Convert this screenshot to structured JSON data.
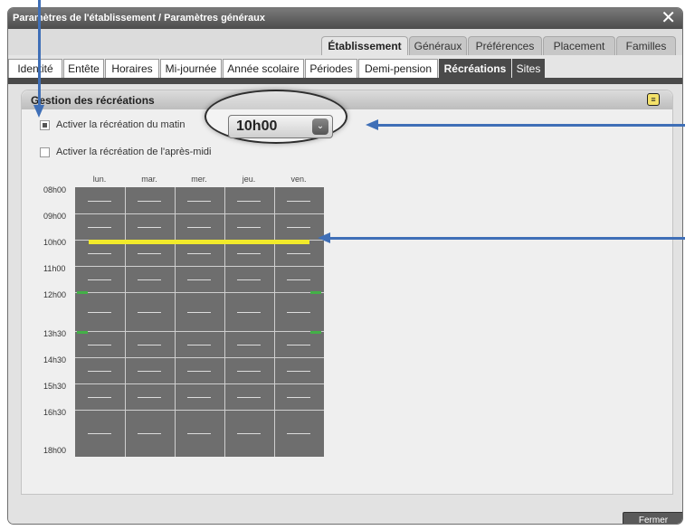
{
  "window": {
    "title": "Paramètres de l'établissement / Paramètres généraux",
    "close_glyph": "✕"
  },
  "tabs_primary": [
    {
      "label": "Établissement",
      "active": true
    },
    {
      "label": "Généraux",
      "active": false
    },
    {
      "label": "Préférences",
      "active": false
    },
    {
      "label": "Placement",
      "active": false
    },
    {
      "label": "Familles",
      "active": false
    }
  ],
  "tabs_secondary": [
    {
      "label": "Identité",
      "active": false
    },
    {
      "label": "Entête",
      "active": false
    },
    {
      "label": "Horaires",
      "active": false
    },
    {
      "label": "Mi-journée",
      "active": false
    },
    {
      "label": "Année scolaire",
      "active": false
    },
    {
      "label": "Périodes",
      "active": false
    },
    {
      "label": "Demi-pension",
      "active": false
    },
    {
      "label": "Récréations",
      "active": true
    },
    {
      "label": "Sites",
      "active": false
    }
  ],
  "panel": {
    "title": "Gestion des récréations",
    "header_icon": "notes-icon"
  },
  "options": {
    "morning": {
      "label": "Activer la récréation du matin",
      "checked": true
    },
    "afternoon": {
      "label": "Activer la récréation de l'après-midi",
      "checked": false
    }
  },
  "morning_time": {
    "value": "10h00",
    "arrow_glyph": "⌄"
  },
  "schedule": {
    "days": [
      "lun.",
      "mar.",
      "mer.",
      "jeu.",
      "ven."
    ],
    "hours": [
      "08h00",
      "09h00",
      "10h00",
      "11h00",
      "12h00",
      "13h30",
      "14h30",
      "15h30",
      "16h30",
      "18h00"
    ],
    "highlight_color": "#f2ea2a",
    "marker_color": "#43b047"
  },
  "footer": {
    "close_label": "Fermer"
  },
  "annotation_color": "#3f6fb7"
}
